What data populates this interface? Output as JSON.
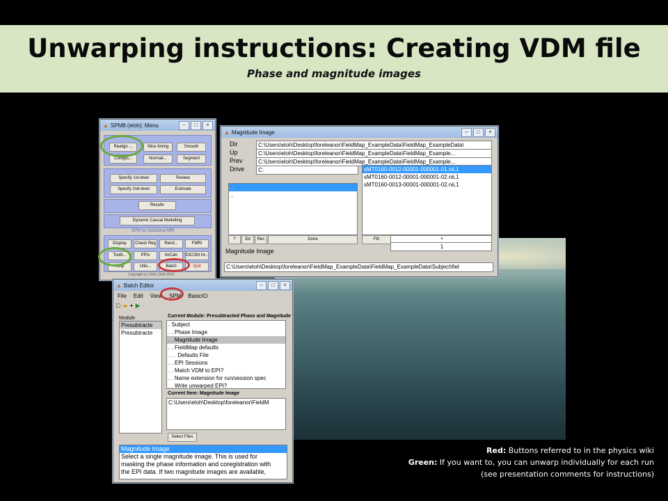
{
  "slide": {
    "title": "Unwarping instructions: Creating VDM file",
    "subtitle": "Phase and magnitude images"
  },
  "spm_menu": {
    "title": "SPM8 (eloh): Menu",
    "buttons": {
      "realign": "Realign ...",
      "slice_timing": "Slice timing",
      "smooth": "Smooth",
      "coregister": "Coregis...",
      "normalise": "Normali...",
      "segment": "Segment",
      "specify_1st": "Specify 1st-level",
      "review": "Review",
      "specify_2nd": "Specify 2nd-level",
      "estimate": "Estimate",
      "results": "Results",
      "dcm": "Dynamic Causal Modelling",
      "display": "Display",
      "check_reg": "Check Reg",
      "render": "Rend...",
      "fmri": "FMRI",
      "toolbox": "Toolb...",
      "ppis": "PPIs",
      "imcalc": "ImCalc",
      "dicom": "DICOM Im...",
      "help": "Help",
      "utils": "Utils...",
      "batch": "Batch",
      "quit": "Quit"
    },
    "footer_label": "SPM for functional MRI",
    "copyright": "Copyright (c) 1991,1994-2010"
  },
  "magnitude_window": {
    "title": "Magnitude Image",
    "dir_label": "Dir",
    "up_label": "Up",
    "prev_label": "Prev",
    "drive_label": "Drive",
    "dir_value": "C:\\Users\\eloh\\Desktop\\foreleanor\\FieldMap_ExampleData\\FieldMap_ExampleData\\",
    "up_value": "C:\\Users\\eloh\\Desktop\\foreleanor\\FieldMap_ExampleData\\FieldMap_Example...",
    "prev_value": "C:\\Users\\eloh\\Desktop\\foreleanor\\FieldMap_ExampleData\\FieldMap_Example...",
    "drive_value": "C:",
    "dir_list": [
      "..",
      ".."
    ],
    "files": [
      "sMT0160-0012-00001-000001-01.nii,1",
      "sMT0160-0012-00001-000001-02.nii,1",
      "sMT0160-0013-00001-000001-02.nii,1"
    ],
    "btn_help": "?",
    "btn_ed": "Ed",
    "btn_rec": "Rec",
    "btn_done": "Done",
    "btn_filt": "Filt",
    "filter_value": "*",
    "frames_value": "1",
    "prompt": "Magnitude Image",
    "selected_path": "C:\\Users\\eloh\\Desktop\\foreleanor\\FieldMap_ExampleData\\FieldMap_ExampleData\\Subject\\fiel"
  },
  "batch_editor": {
    "title": "Batch Editor",
    "menu": [
      "File",
      "Edit",
      "View",
      "SPM",
      "BasicIO"
    ],
    "module_header": "Module",
    "modules": [
      "Presubtracte",
      "Presubtracte"
    ],
    "current_module_header": "Current Module: Presubtracted Phase and Magnitude",
    "tree": [
      ". Subject",
      ". . Phase Image",
      ". . Magnitude Image",
      ". . FieldMap defaults",
      ". . . Defaults File",
      ". . EPI Sessions",
      ". . Match VDM to EPI?",
      ". . Name extension for run/session spec",
      ". . Write unwarped EPI?"
    ],
    "current_item_header": "Current Item: Magnitude Image",
    "current_item_value": "C:\\Users\\eloh\\Desktop\\foreleanor\\FieldM",
    "select_files": "Select Files",
    "help_title": "Magnitude Image",
    "help_lines": [
      "Select  a  single  magnitude  image.  This  is  used  for",
      "masking  the  phase  information  and coregistration with",
      "the  EPI  data.  If  two  magnitude  images  are  available,"
    ]
  },
  "legend": {
    "red_label": "Red:",
    "red_text": "Buttons referred to in the physics wiki",
    "green_label": "Green:",
    "green_text": "If you want to, you can unwarp individually for each run",
    "note": "(see presentation comments for instructions)"
  },
  "colors": {
    "banner": "#d8e6c4",
    "highlight_red": "#c8383c",
    "highlight_green": "#6aa840",
    "selection": "#3399ff"
  }
}
